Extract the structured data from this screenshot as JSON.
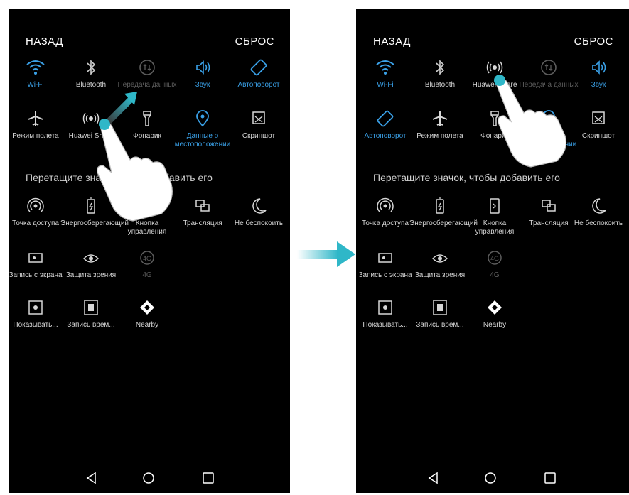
{
  "left": {
    "back": "НАЗАД",
    "reset": "СБРОС",
    "row1": [
      {
        "label": "Wi-Fi",
        "icon": "wifi-icon",
        "state": "blue"
      },
      {
        "label": "Bluetooth",
        "icon": "bluetooth-icon",
        "state": "white"
      },
      {
        "label": "Передача данных",
        "icon": "mobile-data-icon",
        "state": "gray"
      },
      {
        "label": "Звук",
        "icon": "sound-icon",
        "state": "blue"
      },
      {
        "label": "Автоповорот",
        "icon": "autorotate-icon",
        "state": "blue"
      }
    ],
    "row2": [
      {
        "label": "Режим полета",
        "icon": "airplane-icon",
        "state": "white"
      },
      {
        "label": "Huawei Share",
        "icon": "huawei-share-icon",
        "state": "white"
      },
      {
        "label": "Фонарик",
        "icon": "flashlight-icon",
        "state": "white"
      },
      {
        "label": "Данные о местоположении",
        "icon": "location-icon",
        "state": "blue"
      },
      {
        "label": "Скриншот",
        "icon": "screenshot-icon",
        "state": "white"
      }
    ],
    "drag_hint": "Перетащите значок, чтобы добавить его",
    "row3": [
      {
        "label": "Точка доступа",
        "icon": "hotspot-icon"
      },
      {
        "label": "Энергосберегающий",
        "icon": "battery-saver-icon"
      },
      {
        "label": "Кнопка управления",
        "icon": "nav-dock-icon"
      },
      {
        "label": "Трансляция",
        "icon": "cast-icon"
      },
      {
        "label": "Не беспокоить",
        "icon": "moon-icon"
      }
    ],
    "row4": [
      {
        "label": "Запись с экрана",
        "icon": "screen-record-icon"
      },
      {
        "label": "Защита зрения",
        "icon": "eye-comfort-icon"
      },
      {
        "label": "4G",
        "icon": "4g-icon"
      }
    ],
    "row5": [
      {
        "label": "Показывать...",
        "icon": "show-icon"
      },
      {
        "label": "Запись врем...",
        "icon": "time-record-icon"
      },
      {
        "label": "Nearby",
        "icon": "nearby-icon"
      }
    ]
  },
  "right": {
    "back": "НАЗАД",
    "reset": "СБРОС",
    "row1": [
      {
        "label": "Wi-Fi",
        "icon": "wifi-icon",
        "state": "blue"
      },
      {
        "label": "Bluetooth",
        "icon": "bluetooth-icon",
        "state": "white"
      },
      {
        "label": "Huawei Share",
        "icon": "huawei-share-icon",
        "state": "white"
      },
      {
        "label": "Передача данных",
        "icon": "mobile-data-icon",
        "state": "gray"
      },
      {
        "label": "Звук",
        "icon": "sound-icon",
        "state": "blue"
      }
    ],
    "row2": [
      {
        "label": "Автоповорот",
        "icon": "autorotate-icon",
        "state": "blue"
      },
      {
        "label": "Режим полета",
        "icon": "airplane-icon",
        "state": "white"
      },
      {
        "label": "Фонарик",
        "icon": "flashlight-icon",
        "state": "white"
      },
      {
        "label": "Данные о местоположении",
        "icon": "location-icon",
        "state": "blue"
      },
      {
        "label": "Скриншот",
        "icon": "screenshot-icon",
        "state": "white"
      }
    ],
    "drag_hint": "Перетащите значок, чтобы добавить его",
    "row3": [
      {
        "label": "Точка доступа",
        "icon": "hotspot-icon"
      },
      {
        "label": "Энергосберегающий",
        "icon": "battery-saver-icon"
      },
      {
        "label": "Кнопка управления",
        "icon": "nav-dock-icon"
      },
      {
        "label": "Трансляция",
        "icon": "cast-icon"
      },
      {
        "label": "Не беспокоить",
        "icon": "moon-icon"
      }
    ],
    "row4": [
      {
        "label": "Запись с экрана",
        "icon": "screen-record-icon"
      },
      {
        "label": "Защита зрения",
        "icon": "eye-comfort-icon"
      },
      {
        "label": "4G",
        "icon": "4g-icon"
      }
    ],
    "row5": [
      {
        "label": "Показывать...",
        "icon": "show-icon"
      },
      {
        "label": "Запись врем...",
        "icon": "time-record-icon"
      },
      {
        "label": "Nearby",
        "icon": "nearby-icon"
      }
    ]
  },
  "navbar": {
    "back_icon": "back-icon",
    "home_icon": "home-icon",
    "recents_icon": "recents-icon"
  },
  "colors": {
    "accent": "#3aa1e8",
    "teal": "#2fb7c8",
    "inactive": "#5d5d5d"
  }
}
